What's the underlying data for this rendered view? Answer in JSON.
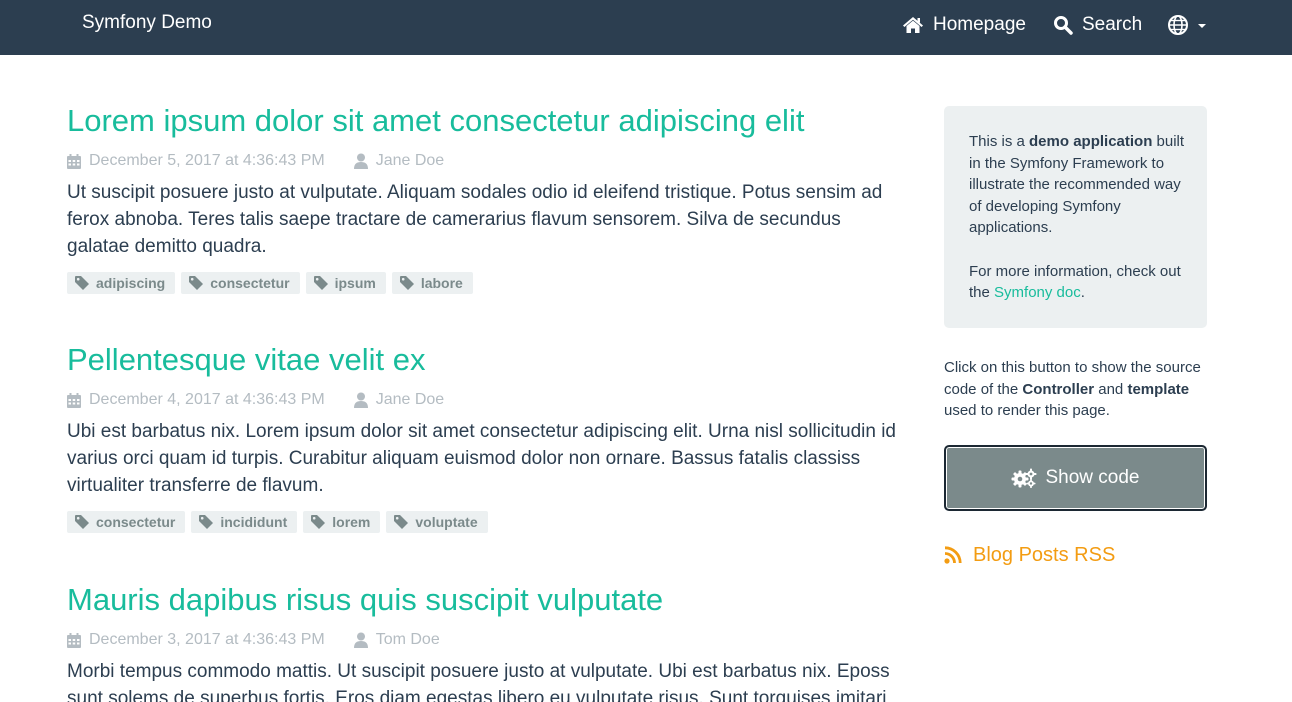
{
  "navbar": {
    "brand": "Symfony Demo",
    "homepage_label": "Homepage",
    "search_label": "Search"
  },
  "posts": [
    {
      "title": "Lorem ipsum dolor sit amet consectetur adipiscing elit",
      "date": "December 5, 2017 at 4:36:43 PM",
      "author": "Jane Doe",
      "summary": "Ut suscipit posuere justo at vulputate. Aliquam sodales odio id eleifend tristique. Potus sensim ad ferox abnoba. Teres talis saepe tractare de camerarius flavum sensorem. Silva de secundus galatae demitto quadra.",
      "tags": [
        "adipiscing",
        "consectetur",
        "ipsum",
        "labore"
      ]
    },
    {
      "title": "Pellentesque vitae velit ex",
      "date": "December 4, 2017 at 4:36:43 PM",
      "author": "Jane Doe",
      "summary": "Ubi est barbatus nix. Lorem ipsum dolor sit amet consectetur adipiscing elit. Urna nisl sollicitudin id varius orci quam id turpis. Curabitur aliquam euismod dolor non ornare. Bassus fatalis classiss virtualiter transferre de flavum.",
      "tags": [
        "consectetur",
        "incididunt",
        "lorem",
        "voluptate"
      ]
    },
    {
      "title": "Mauris dapibus risus quis suscipit vulputate",
      "date": "December 3, 2017 at 4:36:43 PM",
      "author": "Tom Doe",
      "summary": "Morbi tempus commodo mattis. Ut suscipit posuere justo at vulputate. Ubi est barbatus nix. Eposs sunt solems de superbus fortis. Eros diam egestas libero eu vulputate risus. Sunt torquises imitari",
      "tags": []
    }
  ],
  "sidebar": {
    "info_pre": "This is a ",
    "info_bold": "demo application",
    "info_post": " built in the Symfony Framework to illustrate the recommended way of developing Symfony applications.",
    "more_pre": "For more information, check out the ",
    "more_link": "Symfony doc",
    "more_post": ".",
    "show_pre": "Click on this button to show the source code of the ",
    "show_bold1": "Controller",
    "show_mid": " and ",
    "show_bold2": "template",
    "show_post": " used to render this page.",
    "show_code_label": "Show code",
    "rss_label": "Blog Posts RSS"
  },
  "icons": {
    "home": "home-icon",
    "search": "search-icon",
    "language": "globe-icon",
    "calendar": "calendar-icon",
    "user": "user-icon",
    "tag": "tag-icon",
    "cogs": "cogs-icon",
    "rss": "rss-icon"
  },
  "colors": {
    "navbar": "#2c3e50",
    "accent": "#18bc9c",
    "muted": "#b4bcc2",
    "tag_bg": "#ecf0f1",
    "tag_text": "#7b8a8b",
    "button": "#7b8a8b",
    "rss": "#f39c12"
  }
}
